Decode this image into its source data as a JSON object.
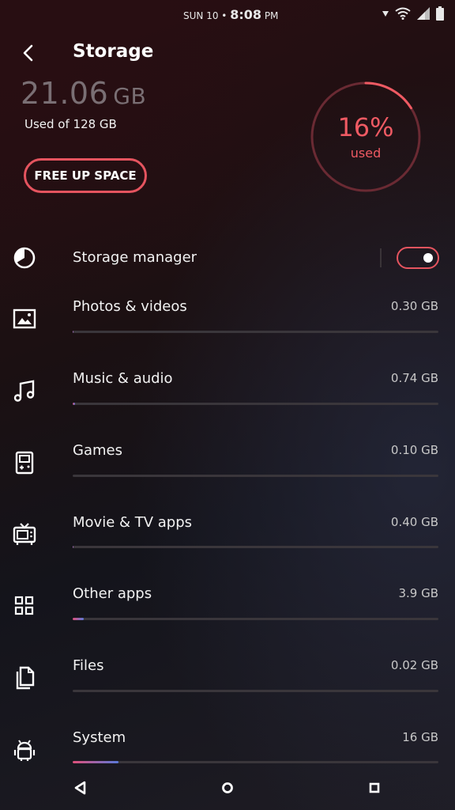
{
  "status_bar": {
    "date": "SUN 10 •",
    "time": "8:08",
    "ampm": "PM",
    "icons": [
      "arrow-down-icon",
      "wifi-icon",
      "signal-icon",
      "battery-icon"
    ]
  },
  "header": {
    "title": "Storage",
    "used_value": "21.06",
    "used_unit": "GB",
    "used_of": "Used of 128 GB",
    "free_up_label": "FREE UP SPACE"
  },
  "gauge": {
    "percent_label": "16%",
    "sub_label": "used",
    "fraction": 0.16
  },
  "storage_manager": {
    "label": "Storage manager",
    "enabled": true
  },
  "categories": [
    {
      "icon": "image-icon",
      "label": "Photos & videos",
      "value": "0.30 GB",
      "fraction": 0.0023
    },
    {
      "icon": "music-note-icon",
      "label": "Music & audio",
      "value": "0.74 GB",
      "fraction": 0.0058
    },
    {
      "icon": "gameboy-icon",
      "label": "Games",
      "value": "0.10 GB",
      "fraction": 0.0008
    },
    {
      "icon": "tv-icon",
      "label": "Movie & TV apps",
      "value": "0.40 GB",
      "fraction": 0.0031
    },
    {
      "icon": "apps-grid-icon",
      "label": "Other apps",
      "value": "3.9 GB",
      "fraction": 0.03
    },
    {
      "icon": "files-icon",
      "label": "Files",
      "value": "0.02 GB",
      "fraction": 0.0002
    },
    {
      "icon": "android-icon",
      "label": "System",
      "value": "16 GB",
      "fraction": 0.125
    }
  ],
  "colors": {
    "accent": "#e5545f",
    "bar_gradient_start": "#e0507a",
    "bar_gradient_end": "#5a78d8",
    "track": "#3a363b"
  },
  "nav_bar": {
    "icons": [
      "back-triangle-icon",
      "home-circle-icon",
      "recents-square-icon"
    ]
  }
}
